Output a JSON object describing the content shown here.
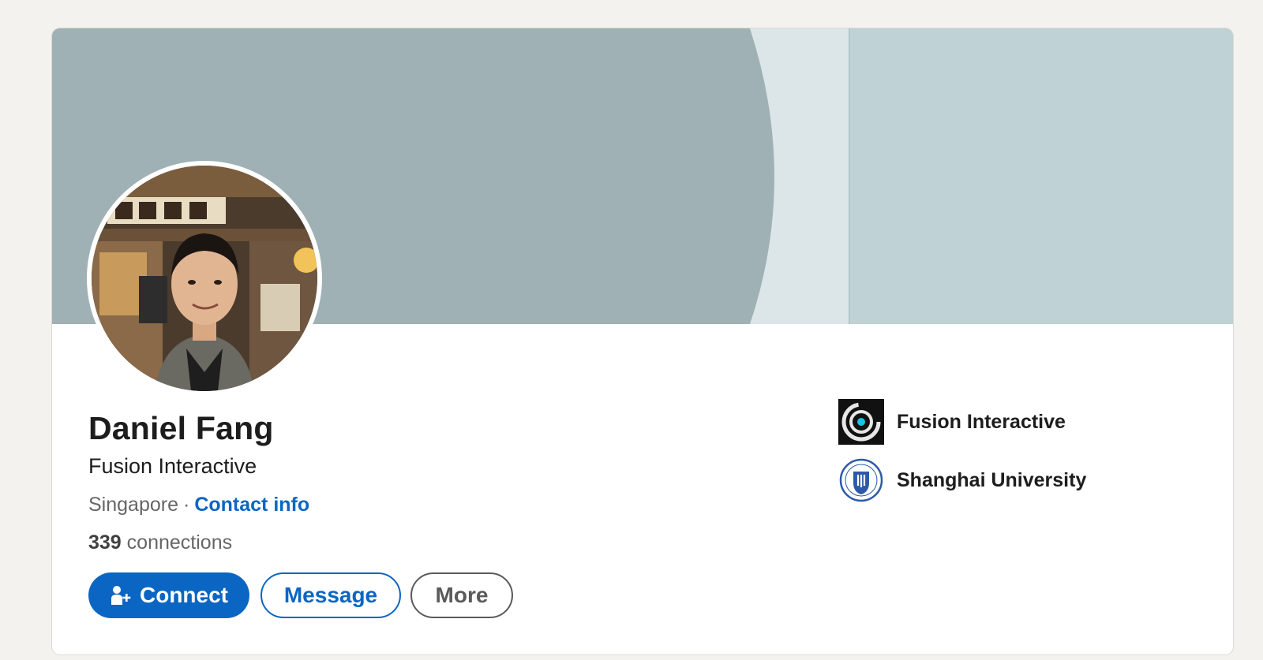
{
  "profile": {
    "name": "Daniel Fang",
    "headline": "Fusion Interactive",
    "location": "Singapore",
    "separator": "·",
    "contact_info_label": "Contact info",
    "connections_count": "339",
    "connections_label": "connections"
  },
  "actions": {
    "connect_label": "Connect",
    "message_label": "Message",
    "more_label": "More"
  },
  "organizations": [
    {
      "name": "Fusion Interactive",
      "icon": "fusion-interactive-logo"
    },
    {
      "name": "Shanghai University",
      "icon": "shanghai-university-logo"
    }
  ],
  "colors": {
    "accent": "#0a66c2",
    "banner_dark": "#9fb1b4",
    "banner_light": "#bfd2d6",
    "background": "#f4f2ee"
  }
}
